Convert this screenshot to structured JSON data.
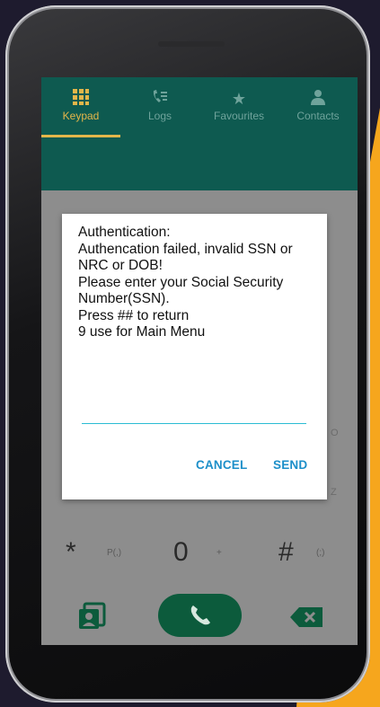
{
  "tabs": [
    {
      "label": "Keypad",
      "icon": "keypad-icon"
    },
    {
      "label": "Logs",
      "icon": "logs-icon"
    },
    {
      "label": "Favourites",
      "icon": "star-icon"
    },
    {
      "label": "Contacts",
      "icon": "contact-icon"
    }
  ],
  "dialog": {
    "message": "Authentication:\nAuthencation failed, invalid SSN or NRC or DOB!\nPlease enter your Social Security Number(SSN).\nPress ## to return\n9 use for Main Menu",
    "input_value": "",
    "cancel_label": "CANCEL",
    "send_label": "SEND"
  },
  "keypad": {
    "star_key": "*",
    "star_sub": "P(,)",
    "zero_key": "0",
    "zero_sub": "+",
    "hash_key": "#",
    "hash_sub": "(;)"
  },
  "ghost_letters": {
    "right_1": "O",
    "right_2": "Z"
  },
  "colors": {
    "background": "#f6a61d",
    "appbar": "#0e5a50",
    "tab_active": "#e3b64a",
    "call_button": "#0c5b3c",
    "dialog_button": "#1d8fc9"
  }
}
